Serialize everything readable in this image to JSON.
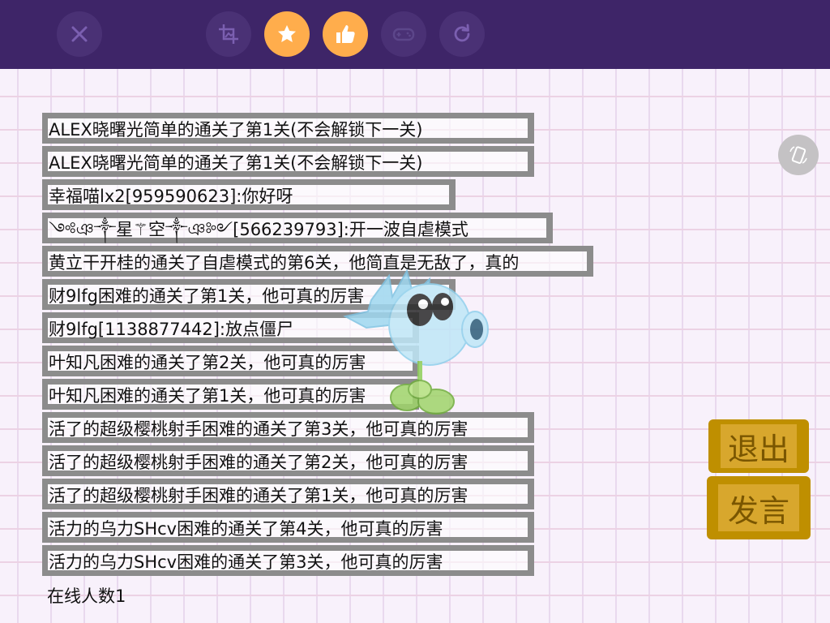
{
  "toolbar": {
    "buttons": [
      {
        "name": "close-icon"
      },
      {
        "name": "crop-icon"
      },
      {
        "name": "star-icon",
        "active": true
      },
      {
        "name": "thumbs-up-icon",
        "active": true
      },
      {
        "name": "gamepad-icon"
      },
      {
        "name": "refresh-icon"
      }
    ],
    "bar_color": "#3e2568",
    "active_color": "#ffad4c"
  },
  "chat": {
    "messages": [
      "ALEX晓曙光简单的通关了第1关(不会解锁下一关)",
      "ALEX晓曙光简单的通关了第1关(不会解锁下一关)",
      "幸福喵lx2[959590623]:你好呀",
      "༺ঞ༒星⚚空༒ঞ༻[566239793]:开一波自虐模式",
      "黄立干开桂的通关了自虐模式的第6关，他简直是无敌了，真的",
      "财9lfg困难的通关了第1关，他可真的厉害",
      "财9lfg[1138877442]:放点僵尸",
      "叶知凡困难的通关了第2关，他可真的厉害",
      "叶知凡困难的通关了第1关，他可真的厉害",
      "活了的超级樱桃射手困难的通关了第3关，他可真的厉害",
      "活了的超级樱桃射手困难的通关了第2关，他可真的厉害",
      "活了的超级樱桃射手困难的通关了第1关，他可真的厉害",
      "活力的乌力SHcv困难的通关了第4关，他可真的厉害",
      "活力的乌力SHcv困难的通关了第3关，他可真的厉害"
    ],
    "online_label": "在线人数1"
  },
  "actions": {
    "exit_label": "退出",
    "speak_label": "发言"
  }
}
